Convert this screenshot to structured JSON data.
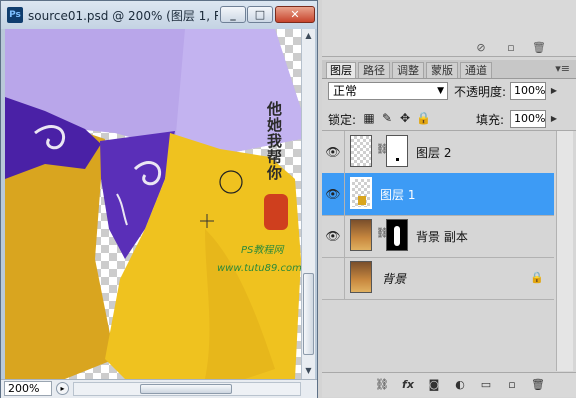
{
  "document_window": {
    "app_icon": "Ps",
    "title": "source01.psd @ 200% (图层 1, R...",
    "controls": {
      "minimize": "_",
      "maximize": "□",
      "close": "✕"
    },
    "zoom": "200%",
    "canvas": {
      "watermark_vertical": "他她我帮你",
      "watermark_line1": "PS教程网",
      "watermark_line2": "www.tutu89.com"
    }
  },
  "layers_panel": {
    "tabs": [
      {
        "label": "图层",
        "active": true
      },
      {
        "label": "路径",
        "active": false
      },
      {
        "label": "调整",
        "active": false
      },
      {
        "label": "蒙版",
        "active": false
      },
      {
        "label": "通道",
        "active": false
      }
    ],
    "panel_menu_icon": "panel-menu-icon",
    "blend_mode": "正常",
    "opacity_label": "不透明度:",
    "opacity_value": "100%",
    "lock_label": "锁定:",
    "fill_label": "填充:",
    "fill_value": "100%",
    "layers": [
      {
        "name": "图层 2",
        "visible": true,
        "selected": false,
        "has_mask": true,
        "thumb": "checker",
        "mask": "white"
      },
      {
        "name": "图层 1",
        "visible": true,
        "selected": true,
        "has_mask": false,
        "thumb": "checker",
        "mask": ""
      },
      {
        "name": "背景 副本",
        "visible": true,
        "selected": false,
        "has_mask": true,
        "thumb": "photo",
        "mask": "black"
      },
      {
        "name": "背景",
        "visible": false,
        "selected": false,
        "has_mask": false,
        "thumb": "photo",
        "locked": true
      }
    ],
    "bottom_icons": [
      "link-icon",
      "fx-icon",
      "mask-icon",
      "adjustment-icon",
      "group-icon",
      "new-layer-icon",
      "trash-icon"
    ]
  }
}
